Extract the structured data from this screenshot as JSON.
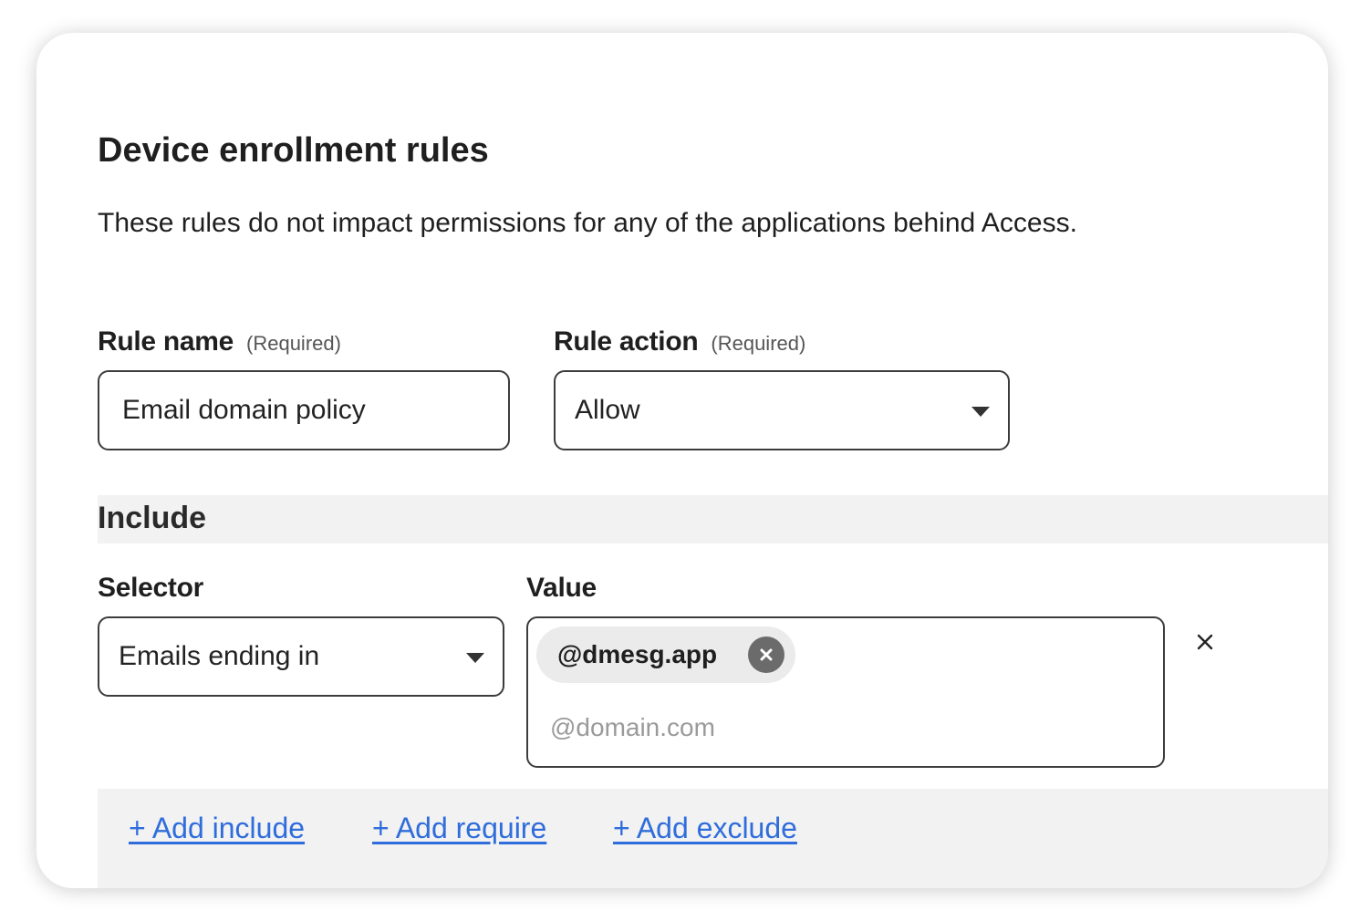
{
  "header": {
    "title": "Device enrollment rules",
    "description": "These rules do not impact permissions for any of the applications behind Access."
  },
  "rule_name": {
    "label": "Rule name",
    "required": "(Required)",
    "value": "Email domain policy"
  },
  "rule_action": {
    "label": "Rule action",
    "required": "(Required)",
    "value": "Allow"
  },
  "include": {
    "heading": "Include",
    "selector_label": "Selector",
    "selector_value": "Emails ending in",
    "value_label": "Value",
    "chips": [
      "@dmesg.app"
    ],
    "value_placeholder": "@domain.com"
  },
  "actions": {
    "add_include": "+ Add include",
    "add_require": "+ Add require",
    "add_exclude": "+ Add exclude"
  },
  "icons": {
    "dropdown": "chevron-down-icon",
    "chip_remove": "close-circle-icon",
    "row_remove": "close-icon"
  },
  "colors": {
    "link": "#2f6ddc",
    "section_bg": "#f2f2f2",
    "chip_bg": "#ebebeb",
    "border": "#3c3c3c"
  }
}
